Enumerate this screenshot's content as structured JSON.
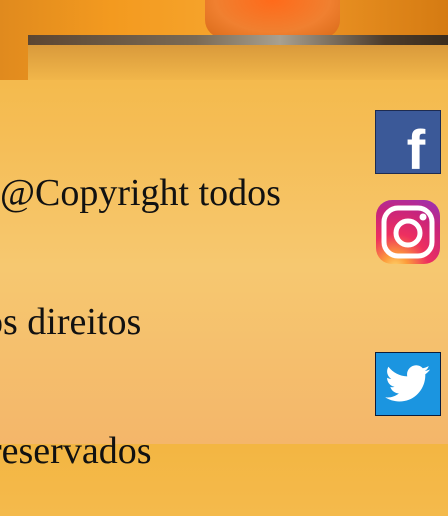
{
  "footer": {
    "copyright_lines": [
      "@Copyright todos",
      "os direitos",
      "reservados"
    ]
  },
  "social": {
    "facebook": {
      "glyph": "f",
      "color": "#3b5998",
      "icon": "facebook-icon"
    },
    "instagram": {
      "icon": "instagram-icon"
    },
    "twitter": {
      "color": "#1b95e0",
      "icon": "twitter-icon"
    }
  },
  "colors": {
    "background": "#f5bd55"
  }
}
